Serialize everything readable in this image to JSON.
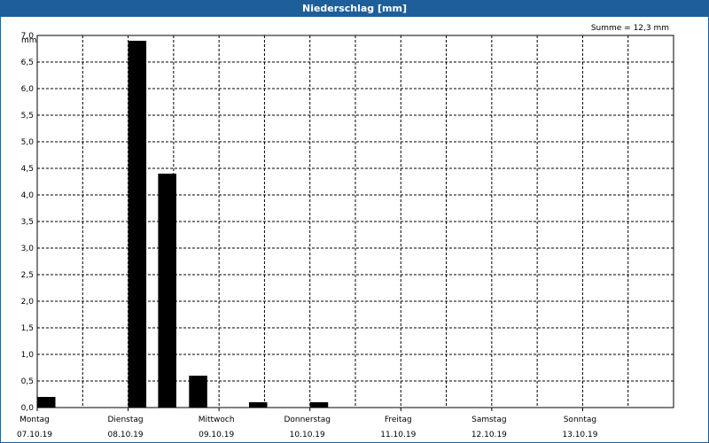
{
  "window": {
    "title": "Niederschlag [mm]"
  },
  "chart_data": {
    "type": "bar",
    "unit_label": "mm",
    "summary": "Summe = 12,3 mm",
    "ylim": [
      0,
      7.0
    ],
    "y_ticks": [
      "0,0",
      "0,5",
      "1,0",
      "1,5",
      "2,0",
      "2,5",
      "3,0",
      "3,5",
      "4,0",
      "4,5",
      "5,0",
      "5,5",
      "6,0",
      "6,5",
      "7,0"
    ],
    "x_range": [
      0,
      7
    ],
    "days": [
      {
        "weekday": "Montag",
        "date": "07.10.19"
      },
      {
        "weekday": "Dienstag",
        "date": "08.10.19"
      },
      {
        "weekday": "Mittwoch",
        "date": "09.10.19"
      },
      {
        "weekday": "Donnerstag",
        "date": "10.10.19"
      },
      {
        "weekday": "Freitag",
        "date": "11.10.19"
      },
      {
        "weekday": "Samstag",
        "date": "12.10.19"
      },
      {
        "weekday": "Sonntag",
        "date": "13.10.19"
      }
    ],
    "bars": [
      {
        "start": 0.0,
        "end": 0.2,
        "value": 0.2
      },
      {
        "start": 1.0,
        "end": 1.2,
        "value": 6.9
      },
      {
        "start": 1.33,
        "end": 1.53,
        "value": 4.4
      },
      {
        "start": 1.67,
        "end": 1.87,
        "value": 0.6
      },
      {
        "start": 2.33,
        "end": 2.53,
        "value": 0.1
      },
      {
        "start": 3.0,
        "end": 3.2,
        "value": 0.1
      }
    ],
    "grid": true,
    "colors": {
      "bar": "#000000",
      "titlebar": "#1f5f99",
      "grid": "#000000"
    }
  }
}
